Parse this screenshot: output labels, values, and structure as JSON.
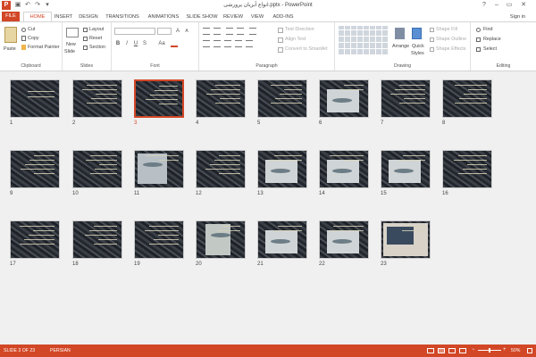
{
  "window": {
    "title": "انواع آبزیان پرورشی.pptx - PowerPoint",
    "help": "?",
    "minimize": "–",
    "restore": "▭",
    "close": "✕"
  },
  "qat": {
    "app_icon": "P",
    "save": "▣",
    "undo": "↶",
    "redo": "↷",
    "customize": "▾"
  },
  "tabs": {
    "file": "FILE",
    "home": "HOME",
    "insert": "INSERT",
    "design": "DESIGN",
    "transitions": "TRANSITIONS",
    "animations": "ANIMATIONS",
    "slideshow": "SLIDE SHOW",
    "review": "REVIEW",
    "view": "VIEW",
    "addins": "ADD-INS"
  },
  "sign_in": "Sign in",
  "ribbon": {
    "clipboard": {
      "label": "Clipboard",
      "paste": "Paste",
      "cut": "Cut",
      "copy": "Copy",
      "format_painter": "Format Painter"
    },
    "slides": {
      "label": "Slides",
      "new_slide": "New",
      "new_slide_2": "Slide",
      "layout": "Layout",
      "reset": "Reset",
      "section": "Section"
    },
    "font": {
      "label": "Font",
      "bold": "B",
      "italic": "I",
      "underline": "U",
      "strike": "S",
      "aa": "Aa",
      "grow": "A",
      "shrink": "A"
    },
    "paragraph": {
      "label": "Paragraph",
      "text_direction": "Text Direction",
      "align_text": "Align Text",
      "convert_smartart": "Convert to SmartArt"
    },
    "drawing": {
      "label": "Drawing",
      "arrange": "Arrange",
      "quick_styles": "Quick",
      "quick_styles_2": "Styles",
      "shape_fill": "Shape Fill",
      "shape_outline": "Shape Outline",
      "shape_effects": "Shape Effects"
    },
    "editing": {
      "label": "Editing",
      "find": "Find",
      "replace": "Replace",
      "select": "Select"
    }
  },
  "slides": [
    {
      "n": "1"
    },
    {
      "n": "2"
    },
    {
      "n": "3"
    },
    {
      "n": "4"
    },
    {
      "n": "5"
    },
    {
      "n": "6"
    },
    {
      "n": "7"
    },
    {
      "n": "8"
    },
    {
      "n": "9"
    },
    {
      "n": "10"
    },
    {
      "n": "11"
    },
    {
      "n": "12"
    },
    {
      "n": "13"
    },
    {
      "n": "14"
    },
    {
      "n": "15"
    },
    {
      "n": "16"
    },
    {
      "n": "17"
    },
    {
      "n": "18"
    },
    {
      "n": "19"
    },
    {
      "n": "20"
    },
    {
      "n": "21"
    },
    {
      "n": "22"
    },
    {
      "n": "23"
    }
  ],
  "status": {
    "slide_info": "SLIDE 3 OF 23",
    "language": "PERSIAN",
    "zoom": "50%"
  },
  "colors": {
    "accent": "#d24726",
    "sorter_bg": "#f0f0f0"
  }
}
